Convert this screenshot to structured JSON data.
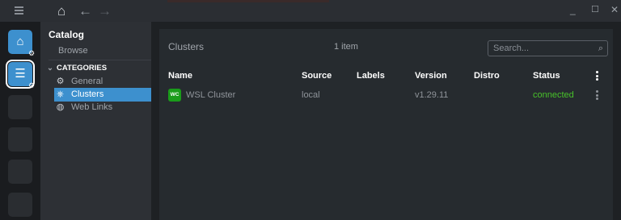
{
  "window": {
    "menu_icon": "hamburger-icon",
    "home_icon": "home-icon",
    "back_icon": "arrow-left-icon",
    "forward_icon": "arrow-right-icon",
    "minimize_glyph": "_",
    "maximize_glyph": "☐",
    "close_glyph": "✕"
  },
  "hotbar": {
    "items": [
      {
        "icon": "home-icon",
        "glyph": "⌂",
        "active": true,
        "has_gear": true
      },
      {
        "icon": "catalog-list-icon",
        "glyph": "☰",
        "active": true,
        "selected": true,
        "has_gear": true
      },
      {
        "icon": "",
        "active": false
      },
      {
        "icon": "",
        "active": false
      },
      {
        "icon": "",
        "active": false
      },
      {
        "icon": "",
        "active": false
      }
    ]
  },
  "sidebar": {
    "title": "Catalog",
    "browse": "Browse",
    "categories_header": "CATEGORIES",
    "items": [
      {
        "label": "General",
        "icon": "gear-icon",
        "active": false
      },
      {
        "label": "Clusters",
        "icon": "kubernetes-icon",
        "active": true
      },
      {
        "label": "Web Links",
        "icon": "globe-icon",
        "active": false
      }
    ]
  },
  "panel": {
    "title": "Clusters",
    "count": "1 item",
    "search": {
      "placeholder": "Search...",
      "value": ""
    },
    "columns": [
      "Name",
      "Source",
      "Labels",
      "Version",
      "Distro",
      "Status"
    ],
    "rows": [
      {
        "badge": "WC",
        "badge_color": "#1a9c1a",
        "name": "WSL Cluster",
        "source": "local",
        "labels": "",
        "version": "v1.29.11",
        "distro": "",
        "status": "connected",
        "status_color": "#48c22a"
      }
    ]
  },
  "colors": {
    "accent": "#3d90ce",
    "panel_bg": "#262b2f",
    "sidebar_bg": "#2d3035"
  }
}
